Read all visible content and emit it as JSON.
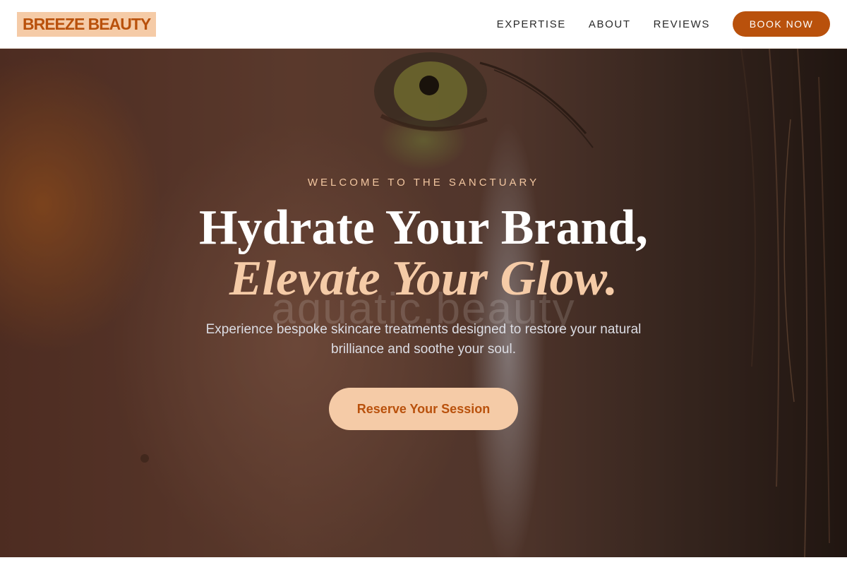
{
  "header": {
    "logo": "BREEZE BEAUTY",
    "nav": [
      {
        "label": "EXPERTISE"
      },
      {
        "label": "ABOUT"
      },
      {
        "label": "REVIEWS"
      }
    ],
    "book_label": "BOOK NOW"
  },
  "hero": {
    "eyebrow": "WELCOME TO THE SANCTUARY",
    "title_line1": "Hydrate Your Brand,",
    "title_line2": "Elevate Your Glow.",
    "watermark": "aquatic.beauty",
    "subtitle": "Experience bespoke skincare treatments designed to restore your natural brilliance and soothe your soul.",
    "cta_label": "Reserve Your Session"
  },
  "colors": {
    "accent": "#b9510c",
    "accent_light": "#f5cba7",
    "header_bg": "#ffffff"
  }
}
